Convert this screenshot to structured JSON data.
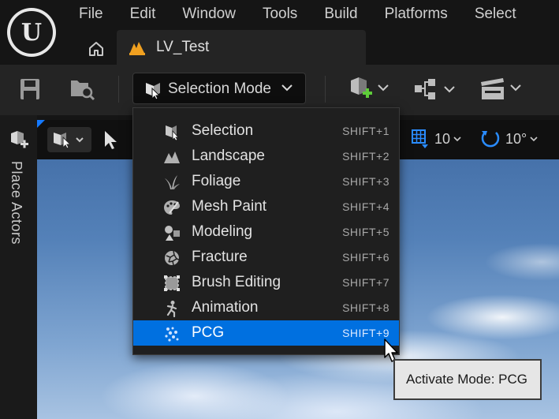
{
  "menu": {
    "items": [
      "File",
      "Edit",
      "Window",
      "Tools",
      "Build",
      "Platforms",
      "Select"
    ]
  },
  "tabs": {
    "document": "LV_Test"
  },
  "toolbar": {
    "mode_label": "Selection Mode",
    "icons": [
      "save-icon",
      "content-browser-icon",
      "add-actor-icon",
      "blueprint-icon",
      "cinematics-icon"
    ]
  },
  "left_panel": {
    "label": "Place Actors"
  },
  "viewport": {
    "grid_snap": "10",
    "rotation_snap": "10°"
  },
  "mode_menu": {
    "items": [
      {
        "label": "Selection",
        "shortcut": "SHIFT+1",
        "icon": "selection-icon"
      },
      {
        "label": "Landscape",
        "shortcut": "SHIFT+2",
        "icon": "landscape-icon"
      },
      {
        "label": "Foliage",
        "shortcut": "SHIFT+3",
        "icon": "foliage-icon"
      },
      {
        "label": "Mesh Paint",
        "shortcut": "SHIFT+4",
        "icon": "mesh-paint-icon"
      },
      {
        "label": "Modeling",
        "shortcut": "SHIFT+5",
        "icon": "modeling-icon"
      },
      {
        "label": "Fracture",
        "shortcut": "SHIFT+6",
        "icon": "fracture-icon"
      },
      {
        "label": "Brush Editing",
        "shortcut": "SHIFT+7",
        "icon": "brush-editing-icon"
      },
      {
        "label": "Animation",
        "shortcut": "SHIFT+8",
        "icon": "animation-icon"
      },
      {
        "label": "PCG",
        "shortcut": "SHIFT+9",
        "icon": "pcg-icon",
        "highlighted": true
      }
    ]
  },
  "tooltip": {
    "text": "Activate Mode: PCG"
  },
  "colors": {
    "accent": "#0070e0",
    "menu_bg": "#1f1f1f",
    "toolbar_bg": "#242424"
  }
}
